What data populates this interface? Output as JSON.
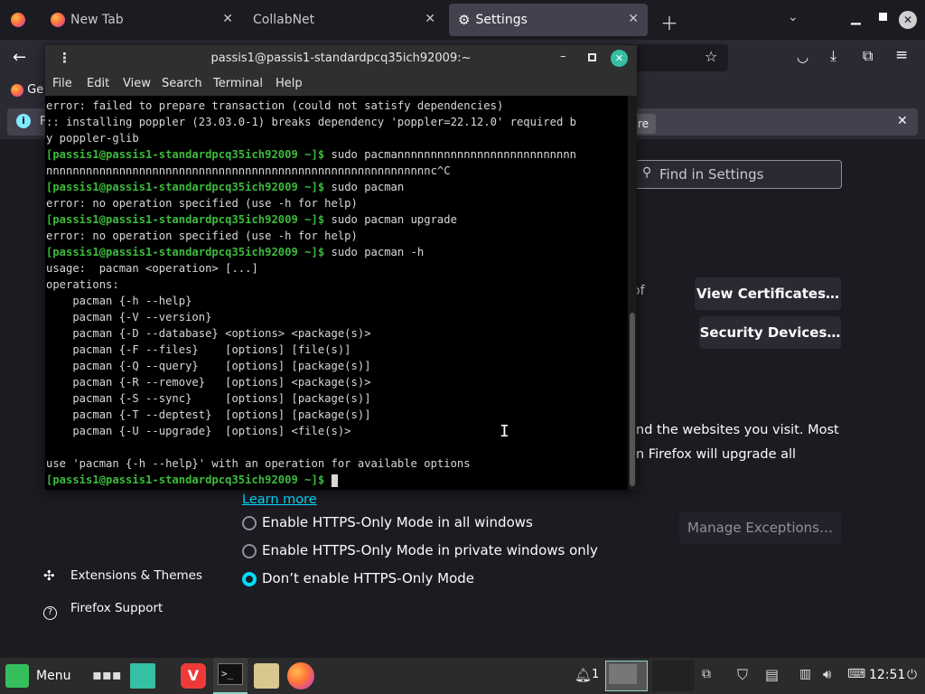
{
  "tabs": [
    {
      "label": "New Tab"
    },
    {
      "label": "CollabNet"
    },
    {
      "label": "Settings"
    }
  ],
  "bookmarks": {
    "first": "Ge"
  },
  "infobar": {
    "left_text": "F",
    "right_text": "re"
  },
  "settings": {
    "find_placeholder": "Find in Settings",
    "view_certificates": "View Certificates…",
    "security_devices": "Security Devices…",
    "fragment_of": "of",
    "https_text_1": "nd the websites you visit. Most",
    "https_text_2": "n Firefox will upgrade all",
    "learn_more": "Learn more",
    "radio_all": "Enable HTTPS-Only Mode in all windows",
    "radio_private": "Enable HTTPS-Only Mode in private windows only",
    "radio_dont": "Don’t enable HTTPS-Only Mode",
    "manage_exceptions": "Manage Exceptions…",
    "sidebar_extensions": "Extensions & Themes",
    "sidebar_support": "Firefox Support"
  },
  "terminal": {
    "title": "passis1@passis1-standardpcq35ich92009:~",
    "menu": [
      "File",
      "Edit",
      "View",
      "Search",
      "Terminal",
      "Help"
    ],
    "lines": [
      {
        "t": "error: failed to prepare transaction (could not satisfy dependencies)"
      },
      {
        "t": ":: installing poppler (23.03.0-1) breaks dependency 'poppler=22.12.0' required b"
      },
      {
        "t": "y poppler-glib"
      },
      {
        "p": "[passis1@passis1-standardpcq35ich92009 ~]$",
        "t": " sudo pacmannnnnnnnnnnnnnnnnnnnnnnnnnn"
      },
      {
        "t": "nnnnnnnnnnnnnnnnnnnnnnnnnnnnnnnnnnnnnnnnnnnnnnnnnnnnnnnnnnc^C"
      },
      {
        "p": "[passis1@passis1-standardpcq35ich92009 ~]$",
        "t": " sudo pacman"
      },
      {
        "t": "error: no operation specified (use -h for help)"
      },
      {
        "p": "[passis1@passis1-standardpcq35ich92009 ~]$",
        "t": " sudo pacman upgrade"
      },
      {
        "t": "error: no operation specified (use -h for help)"
      },
      {
        "p": "[passis1@passis1-standardpcq35ich92009 ~]$",
        "t": " sudo pacman -h"
      },
      {
        "t": "usage:  pacman <operation> [...]"
      },
      {
        "t": "operations:"
      },
      {
        "t": "    pacman {-h --help}"
      },
      {
        "t": "    pacman {-V --version}"
      },
      {
        "t": "    pacman {-D --database} <options> <package(s)>"
      },
      {
        "t": "    pacman {-F --files}    [options] [file(s)]"
      },
      {
        "t": "    pacman {-Q --query}    [options] [package(s)]"
      },
      {
        "t": "    pacman {-R --remove}   [options] <package(s)>"
      },
      {
        "t": "    pacman {-S --sync}     [options] [package(s)]"
      },
      {
        "t": "    pacman {-T --deptest}  [options] [package(s)]"
      },
      {
        "t": "    pacman {-U --upgrade}  [options] <file(s)>"
      },
      {
        "t": ""
      },
      {
        "t": "use 'pacman {-h --help}' with an operation for available options"
      },
      {
        "p": "[passis1@passis1-standardpcq35ich92009 ~]$",
        "t": " ",
        "cursor": true
      }
    ]
  },
  "taskbar": {
    "menu_label": "Menu",
    "notif_count": "1",
    "clock": "12:51"
  }
}
